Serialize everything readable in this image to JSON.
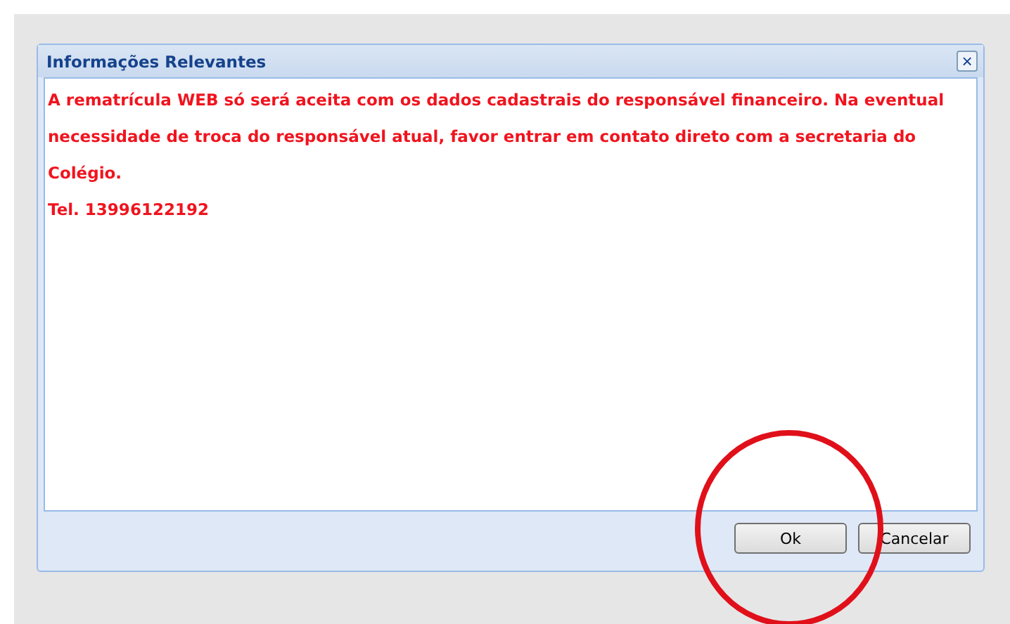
{
  "dialog": {
    "title": "Informações Relevantes",
    "close": "×",
    "message": [
      "A rematrícula WEB só será aceita com os dados cadastrais do responsável financeiro. Na eventual necessidade de troca do responsável atual, favor entrar em contato direto com a secretaria do Colégio.",
      "Tel. 13996122192"
    ],
    "buttons": [
      "Ok",
      "Cancelar"
    ]
  }
}
